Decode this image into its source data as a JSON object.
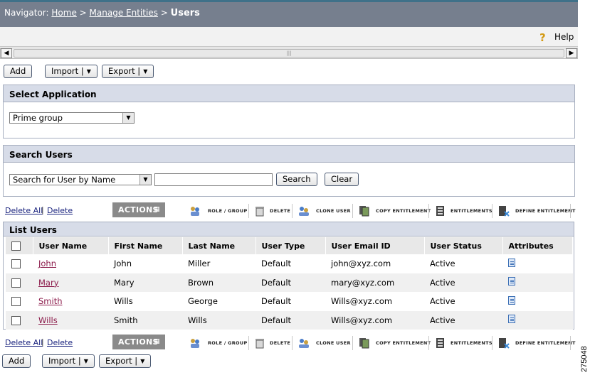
{
  "nav": {
    "prefix": "Navigator:",
    "home": "Home",
    "separator": ">",
    "manage_entities": "Manage Entities",
    "current": "Users",
    "help": "Help"
  },
  "toolbar": {
    "add": "Add",
    "import": "Import |",
    "export": "Export |"
  },
  "select_application": {
    "title": "Select Application",
    "selected": "Prime group"
  },
  "search_users": {
    "title": "Search Users",
    "search_by": "Search for User by Name",
    "search_value": "",
    "search_button": "Search",
    "clear_button": "Clear"
  },
  "action_bar": {
    "delete_all": "Delete All",
    "separator": "|",
    "delete": "Delete",
    "actions_label": "ACTIONS",
    "items": [
      {
        "label": "ROLE / GROUP",
        "icon": "role-group-icon"
      },
      {
        "label": "DELETE",
        "icon": "trash-icon"
      },
      {
        "label": "CLONE USER",
        "icon": "clone-user-icon"
      },
      {
        "label": "COPY ENTITLEMENT",
        "icon": "copy-entitlement-icon"
      },
      {
        "label": "ENTITLEMENTS",
        "icon": "entitlements-icon"
      },
      {
        "label": "DEFINE ENTITLEMENT",
        "icon": "define-entitlement-icon"
      }
    ]
  },
  "list_users": {
    "title": "List Users",
    "columns": [
      "User Name",
      "First Name",
      "Last Name",
      "User Type",
      "User Email ID",
      "User Status",
      "Attributes"
    ],
    "rows": [
      {
        "user_name": "John",
        "first_name": "John",
        "last_name": "Miller",
        "user_type": "Default",
        "email": "john@xyz.com",
        "status": "Active"
      },
      {
        "user_name": "Mary",
        "first_name": "Mary",
        "last_name": "Brown",
        "user_type": "Default",
        "email": "mary@xyz.com",
        "status": "Active"
      },
      {
        "user_name": "Smith",
        "first_name": "Wills",
        "last_name": "George",
        "user_type": "Default",
        "email": "Wills@xyz.com",
        "status": "Active"
      },
      {
        "user_name": "Wills",
        "first_name": "Smith",
        "last_name": "Wills",
        "user_type": "Default",
        "email": "Wills@xyz.com",
        "status": "Active"
      }
    ]
  },
  "figure_id": "275048",
  "colors": {
    "nav_bg": "#767f8e",
    "panel_header": "#d7dce8",
    "user_link": "#8b1a4a",
    "actions_badge": "#8a8a8a"
  }
}
